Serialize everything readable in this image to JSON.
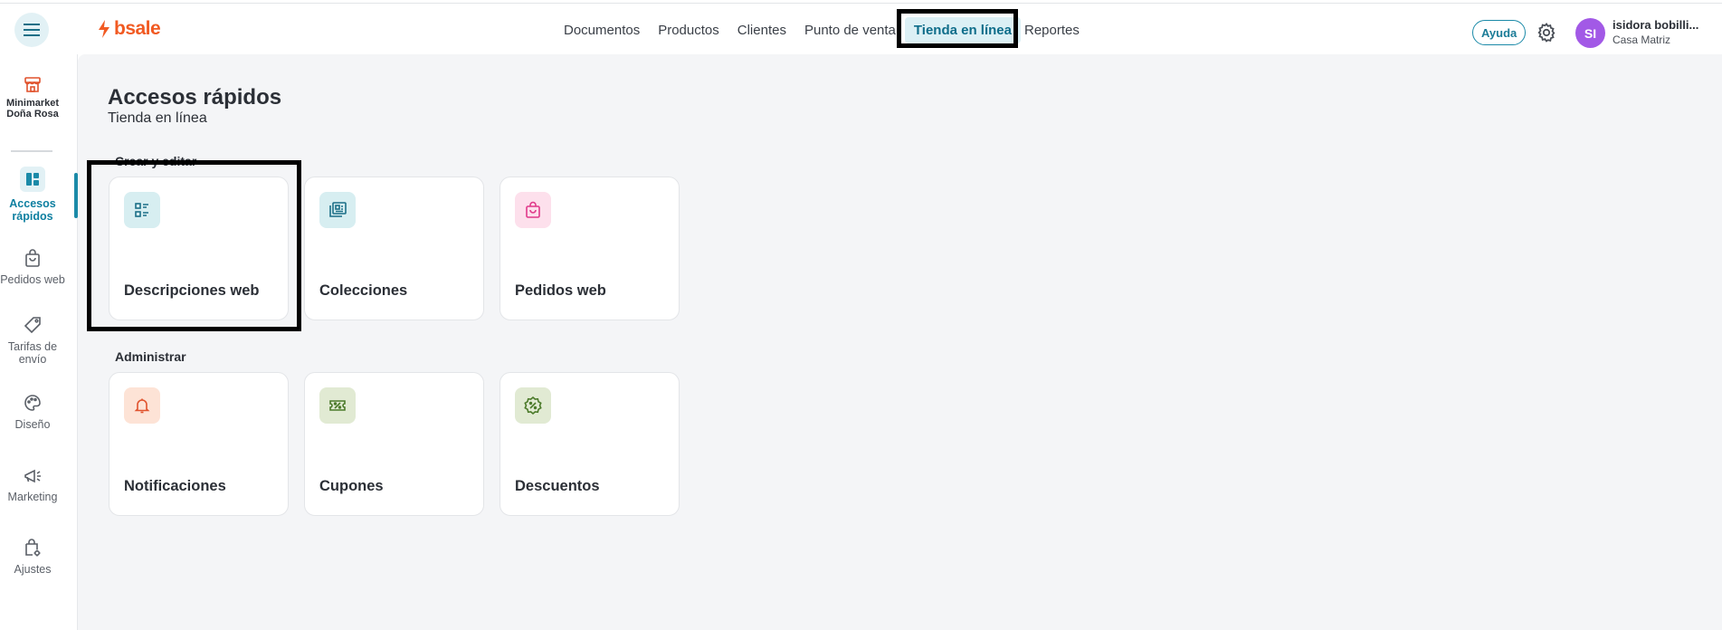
{
  "header": {
    "brand": "bsale",
    "nav": [
      {
        "label": "Documentos",
        "active": false
      },
      {
        "label": "Productos",
        "active": false
      },
      {
        "label": "Clientes",
        "active": false
      },
      {
        "label": "Punto de venta",
        "active": false
      },
      {
        "label": "Tienda en línea",
        "active": true
      },
      {
        "label": "Reportes",
        "active": false
      }
    ],
    "help_label": "Ayuda",
    "user": {
      "initials": "SI",
      "name": "isidora bobilli...",
      "role": "Casa Matriz"
    }
  },
  "sidebar": {
    "store_name_line1": "Minimarket",
    "store_name_line2": "Doña Rosa",
    "items": [
      {
        "label_line1": "Accesos",
        "label_line2": "rápidos",
        "icon": "dashboard-icon",
        "active": true
      },
      {
        "label_line1": "Pedidos web",
        "label_line2": "",
        "icon": "shopping-bag-icon",
        "active": false
      },
      {
        "label_line1": "Tarifas de",
        "label_line2": "envío",
        "icon": "tag-icon",
        "active": false
      },
      {
        "label_line1": "Diseño",
        "label_line2": "",
        "icon": "palette-icon",
        "active": false
      },
      {
        "label_line1": "Marketing",
        "label_line2": "",
        "icon": "megaphone-icon",
        "active": false
      },
      {
        "label_line1": "Ajustes",
        "label_line2": "",
        "icon": "settings-bag-icon",
        "active": false
      }
    ]
  },
  "main": {
    "title": "Accesos rápidos",
    "subtitle": "Tienda en línea",
    "sections": [
      {
        "label": "Crear y editar",
        "cards": [
          {
            "label": "Descripciones web",
            "icon": "list-icon",
            "color": "#d7eef1"
          },
          {
            "label": "Colecciones",
            "icon": "collection-icon",
            "color": "#d7eef1"
          },
          {
            "label": "Pedidos web",
            "icon": "shopping-bag-icon",
            "color": "#fde0ec"
          }
        ]
      },
      {
        "label": "Administrar",
        "cards": [
          {
            "label": "Notificaciones",
            "icon": "bell-icon",
            "color": "#fde3d6"
          },
          {
            "label": "Cupones",
            "icon": "coupon-icon",
            "color": "#e1ead3"
          },
          {
            "label": "Descuentos",
            "icon": "discount-badge-icon",
            "color": "#e1ead3"
          }
        ]
      }
    ]
  },
  "colors": {
    "accent": "#0e7fa0",
    "brand": "#f15a22",
    "avatar": "#a259e6"
  }
}
